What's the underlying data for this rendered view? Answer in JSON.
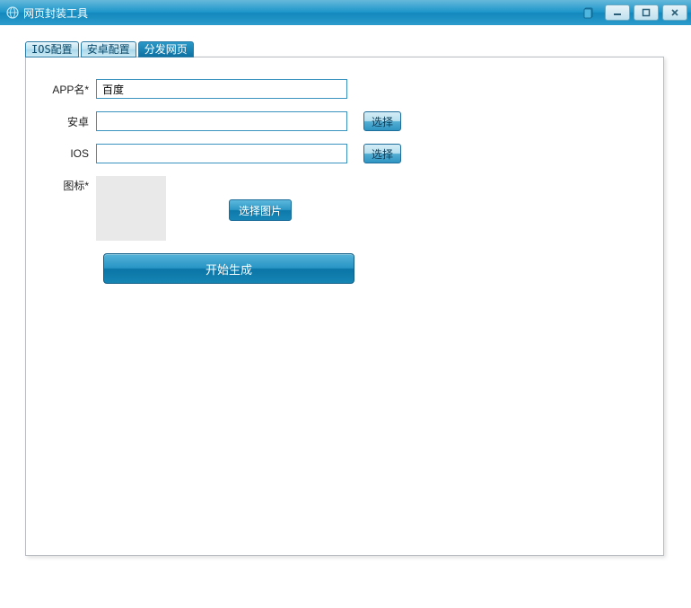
{
  "window": {
    "title": "网页封装工具"
  },
  "tabs": {
    "ios_config": "IOS配置",
    "android_config": "安卓配置",
    "distribute": "分发网页"
  },
  "form": {
    "app_name_label": "APP名*",
    "app_name_value": "百度",
    "android_label": "安卓",
    "android_value": "",
    "ios_label": "IOS",
    "ios_value": "",
    "icon_label": "图标*",
    "choose_btn": "选择",
    "choose_image_btn": "选择图片",
    "generate_btn": "开始生成"
  }
}
